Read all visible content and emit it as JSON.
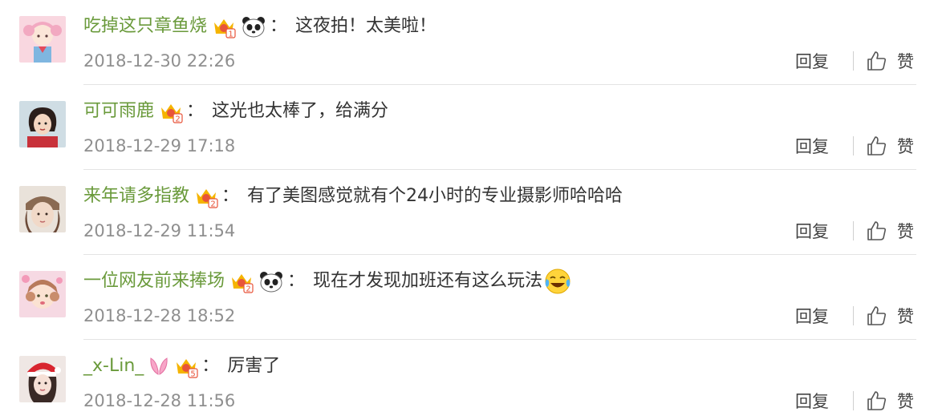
{
  "comments": [
    {
      "username": "吃掉这只章鱼烧",
      "vip_level": "1",
      "badges": [
        "crown-vip-icon",
        "panda-icon"
      ],
      "colon": "：",
      "text": "这夜拍！太美啦！",
      "emoji": "",
      "timestamp": "2018-12-30 22:26",
      "reply_label": "回复",
      "like_label": "赞"
    },
    {
      "username": "可可雨鹿",
      "vip_level": "2",
      "badges": [
        "crown-vip-icon"
      ],
      "colon": "：",
      "text": "这光也太棒了，给满分",
      "emoji": "",
      "timestamp": "2018-12-29 17:18",
      "reply_label": "回复",
      "like_label": "赞"
    },
    {
      "username": "来年请多指教",
      "vip_level": "2",
      "badges": [
        "crown-vip-icon"
      ],
      "colon": "：",
      "text": "有了美图感觉就有个24小时的专业摄影师哈哈哈",
      "emoji": "",
      "timestamp": "2018-12-29 11:54",
      "reply_label": "回复",
      "like_label": "赞"
    },
    {
      "username": "一位网友前来捧场",
      "vip_level": "2",
      "badges": [
        "crown-vip-icon",
        "panda-icon"
      ],
      "colon": "：",
      "text": "现在才发现加班还有这么玩法",
      "emoji": "laughing-crying-icon",
      "timestamp": "2018-12-28 18:52",
      "reply_label": "回复",
      "like_label": "赞"
    },
    {
      "username": "_x-Lin_",
      "vip_level": "5",
      "badges": [
        "bunny-ears-icon",
        "crown-vip-icon"
      ],
      "colon": "：",
      "text": "厉害了",
      "emoji": "",
      "timestamp": "2018-12-28 11:56",
      "reply_label": "回复",
      "like_label": "赞"
    }
  ],
  "colors": {
    "username": "#6a9a3b",
    "text": "#333333",
    "timestamp": "#8f8f8f",
    "action": "#444444",
    "crown": "#f5b400",
    "vip_tag": "#e8543a",
    "divider": "#e4e4e4"
  }
}
